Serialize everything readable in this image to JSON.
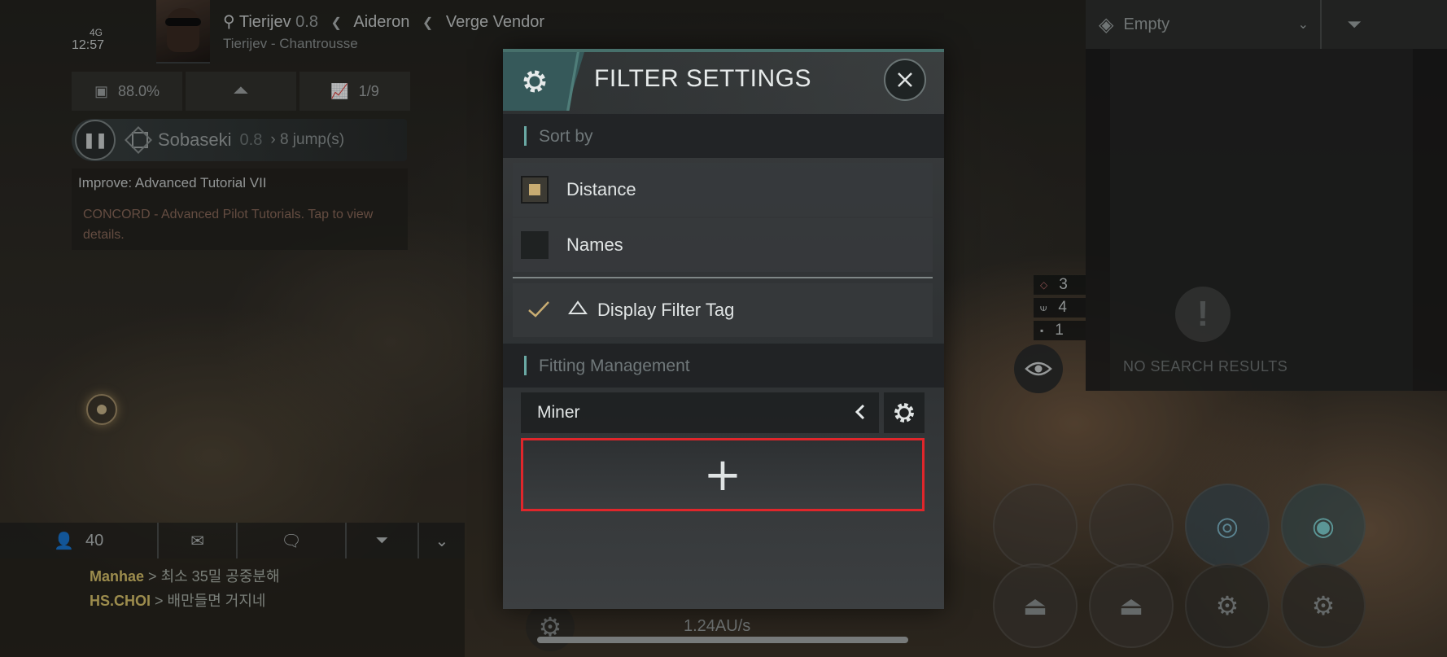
{
  "status": {
    "network": "4G",
    "time": "12:57"
  },
  "location": {
    "system": "Tierijev",
    "security": "0.8",
    "region": "Aideron",
    "faction": "Verge Vendor",
    "station": "Tierijev - Chantrousse"
  },
  "stats": {
    "cargo": "88.0%",
    "count": "1/9"
  },
  "route": {
    "destination": "Sobaseki",
    "security": "0.8",
    "jumps": "8 jump(s)"
  },
  "mission": {
    "title": "Improve: Advanced Tutorial VII",
    "description": "CONCORD - Advanced Pilot Tutorials. Tap to view details."
  },
  "chat": {
    "members": "40",
    "messages": [
      {
        "sender": "Manhae",
        "text": "최소 35밀 공중분해"
      },
      {
        "sender": "HS.CHOI",
        "text": "배만들면 거지네"
      }
    ]
  },
  "overview": {
    "preset": "Empty",
    "empty_text": "NO SEARCH RESULTS",
    "counts": [
      "3",
      "4",
      "1"
    ]
  },
  "speed": "1.24AU/s",
  "dialog": {
    "title": "FILTER SETTINGS",
    "sort_by_label": "Sort by",
    "sort_options": [
      "Distance",
      "Names"
    ],
    "selected_sort": "Distance",
    "display_filter_tag": "Display Filter Tag",
    "display_filter_tag_checked": true,
    "fitting_label": "Fitting Management",
    "fitting_selected": "Miner",
    "add_label": "+"
  },
  "colors": {
    "accent": "#6aa9a4",
    "highlight": "#e0262b",
    "chat_name": "#d9c36b",
    "check": "#c8ac72"
  }
}
